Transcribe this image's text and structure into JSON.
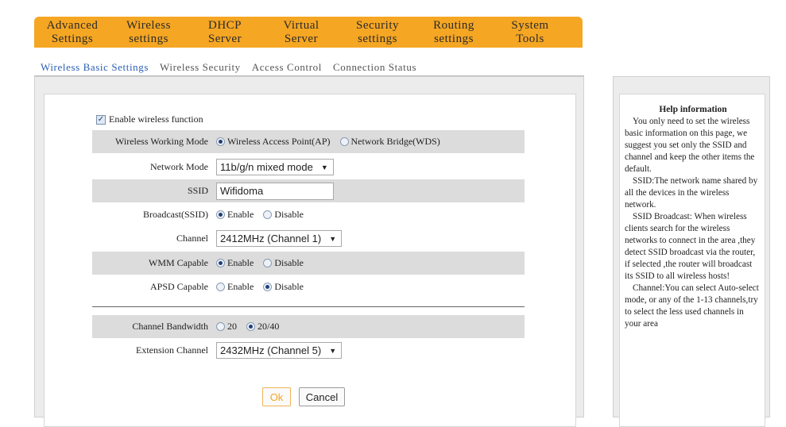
{
  "topnav": [
    {
      "line1": "Advanced",
      "line2": "Settings"
    },
    {
      "line1": "Wireless",
      "line2": "settings"
    },
    {
      "line1": "DHCP",
      "line2": "Server"
    },
    {
      "line1": "Virtual",
      "line2": "Server"
    },
    {
      "line1": "Security",
      "line2": "settings"
    },
    {
      "line1": "Routing",
      "line2": "settings"
    },
    {
      "line1": "System",
      "line2": "Tools"
    }
  ],
  "subnav": [
    "Wireless Basic Settings",
    "Wireless Security",
    "Access Control",
    "Connection Status"
  ],
  "form": {
    "enable_label": "Enable wireless function",
    "enable_checked": "✓",
    "working_mode": {
      "label": "Wireless Working Mode",
      "opt1": "Wireless Access Point(AP)",
      "opt2": "Network Bridge(WDS)"
    },
    "network_mode": {
      "label": "Network Mode",
      "value": "11b/g/n mixed mode"
    },
    "ssid": {
      "label": "SSID",
      "value": "Wifidoma"
    },
    "broadcast": {
      "label": "Broadcast(SSID)",
      "opt1": "Enable",
      "opt2": "Disable"
    },
    "channel": {
      "label": "Channel",
      "value": "2412MHz (Channel 1)"
    },
    "wmm": {
      "label": "WMM Capable",
      "opt1": "Enable",
      "opt2": "Disable"
    },
    "apsd": {
      "label": "APSD Capable",
      "opt1": "Enable",
      "opt2": "Disable"
    },
    "bandwidth": {
      "label": "Channel Bandwidth",
      "opt1": "20",
      "opt2": "20/40"
    },
    "extension": {
      "label": "Extension Channel",
      "value": "2432MHz (Channel 5)"
    },
    "ok": "Ok",
    "cancel": "Cancel"
  },
  "help": {
    "title": "Help information",
    "p1": "You only need to set the wireless basic information on this page, we suggest you set only the SSID and channel and keep the other items the default.",
    "p2": "SSID:The network name shared by all the devices in the wireless network.",
    "p3": "SSID Broadcast: When wireless clients search for the wireless networks to connect in the area ,they detect SSID broadcast via the router, if selected ,the router will broadcast its SSID to all wireless hosts!",
    "p4": "Channel:You can select Auto-select mode, or any of the 1-13 channels,try to select the less used channels in your area"
  },
  "colors": {
    "accent": "#f5a623",
    "active_tab": "#2b5fb4"
  }
}
